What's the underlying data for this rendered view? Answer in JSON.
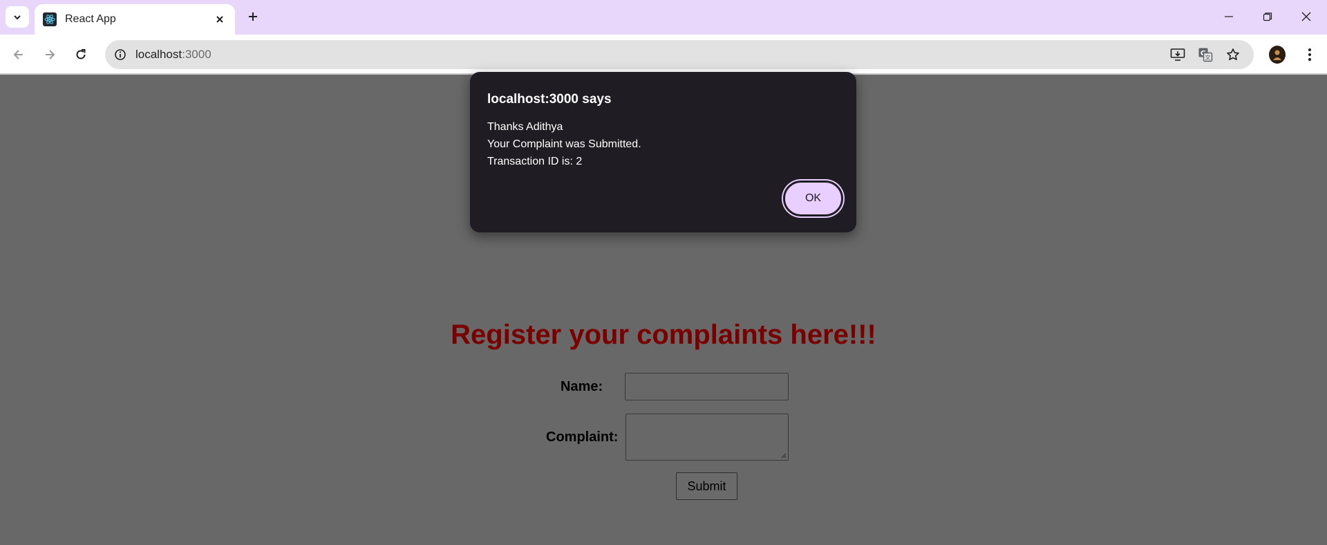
{
  "browser": {
    "tab_title": "React App",
    "url_host": "localhost",
    "url_port": ":3000"
  },
  "page": {
    "heading": "Register your complaints here!!!",
    "name_label": "Name:",
    "complaint_label": "Complaint:",
    "submit_label": "Submit"
  },
  "dialog": {
    "title": "localhost:3000 says",
    "lines": [
      "Thanks Adithya",
      "Your Complaint was Submitted.",
      "Transaction ID is: 2"
    ],
    "ok_label": "OK"
  },
  "colors": {
    "tabstrip": "#e8d7fb",
    "heading": "#7a0000",
    "dialog_bg": "#1f1d23",
    "ok_button": "#e8cfff"
  }
}
